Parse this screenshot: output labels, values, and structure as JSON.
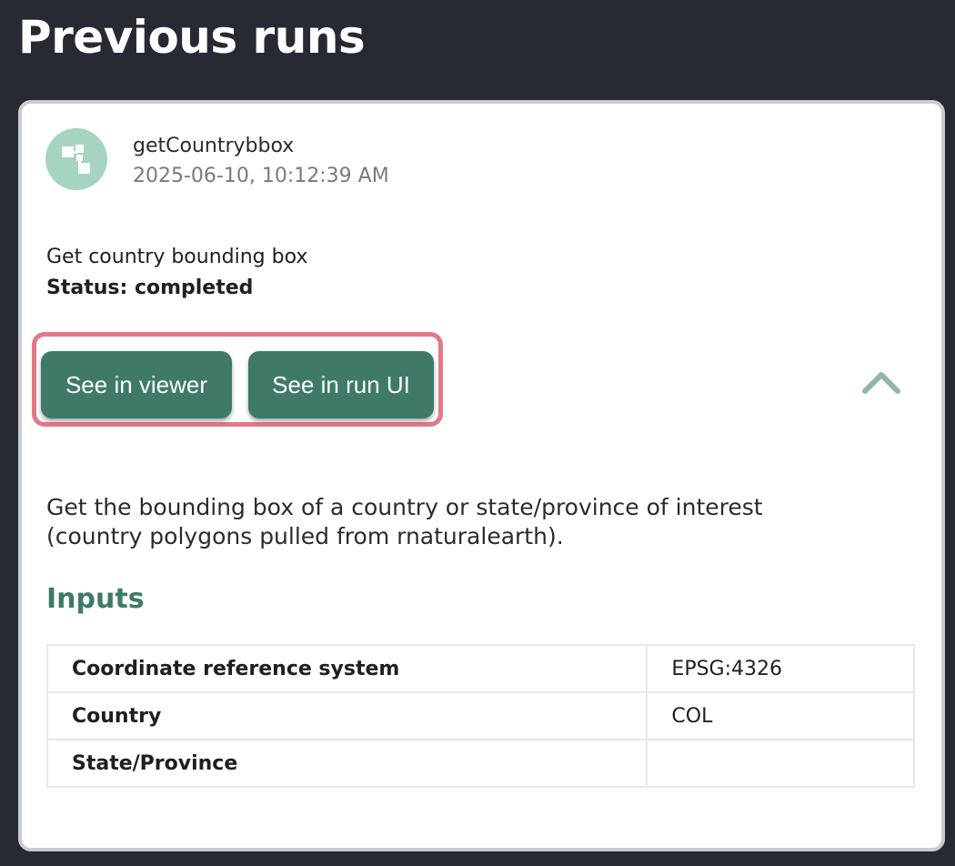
{
  "header": {
    "title": "Previous runs"
  },
  "run": {
    "name": "getCountrybbox",
    "timestamp": "2025-06-10, 10:12:39 AM",
    "description": "Get country bounding box",
    "status": "Status: completed",
    "long_description": "Get the bounding box of a country or state/province of interest (country polygons pulled from rnaturalearth).",
    "icon": "pipeline-icon",
    "actions": {
      "viewer_label": "See in viewer",
      "run_ui_label": "See in run UI"
    },
    "collapse_icon": "chevron-up-icon"
  },
  "inputs": {
    "heading": "Inputs",
    "rows": [
      {
        "key": "Coordinate reference system",
        "value": "EPSG:4326"
      },
      {
        "key": "Country",
        "value": "COL"
      },
      {
        "key": "State/Province",
        "value": ""
      }
    ]
  },
  "colors": {
    "background": "#272a33",
    "accent": "#3f7a69",
    "avatar": "#a7d3c1",
    "highlight": "#e17985"
  }
}
